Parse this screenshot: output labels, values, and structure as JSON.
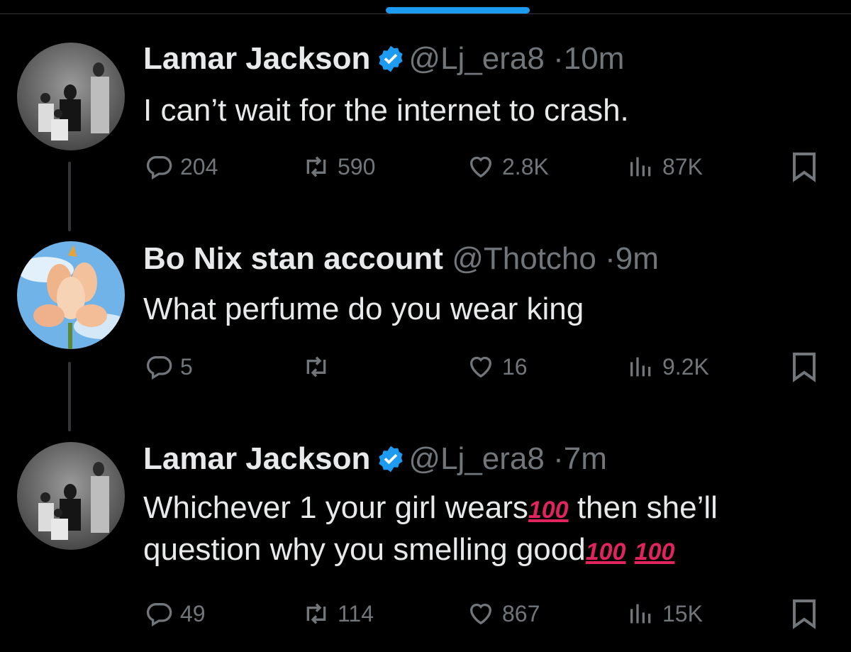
{
  "tweets": [
    {
      "name": "Lamar Jackson",
      "verified": true,
      "handle": "@Lj_era8",
      "separator": "·",
      "time": "10m",
      "text": "I can’t wait for the internet to crash.",
      "replies": "204",
      "reposts": "590",
      "likes": "2.8K",
      "views": "87K"
    },
    {
      "name": "Bo Nix stan account",
      "verified": false,
      "handle": "@Thotcho",
      "separator": "·",
      "time": "9m",
      "text": "What perfume do you wear king",
      "replies": "5",
      "reposts": "",
      "likes": "16",
      "views": "9.2K"
    },
    {
      "name": "Lamar Jackson",
      "verified": true,
      "handle": "@Lj_era8",
      "separator": "·",
      "time": "7m",
      "text_line1_a": "Whichever 1 your girl wears",
      "text_line1_emoji": "100",
      "text_line1_b": " then she’ll",
      "text_line2_a": "question why you smelling good",
      "text_line2_emoji1": "100",
      "text_line2_emoji2": "100",
      "replies": "49",
      "reposts": "114",
      "likes": "867",
      "views": "15K"
    }
  ],
  "colors": {
    "accent": "#1d9bf0",
    "text": "#e7e9ea",
    "muted": "#71767b",
    "emoji_red": "#e0245e"
  },
  "icons": [
    "reply-icon",
    "repost-icon",
    "like-icon",
    "views-icon",
    "bookmark-icon",
    "verified-badge-icon"
  ]
}
